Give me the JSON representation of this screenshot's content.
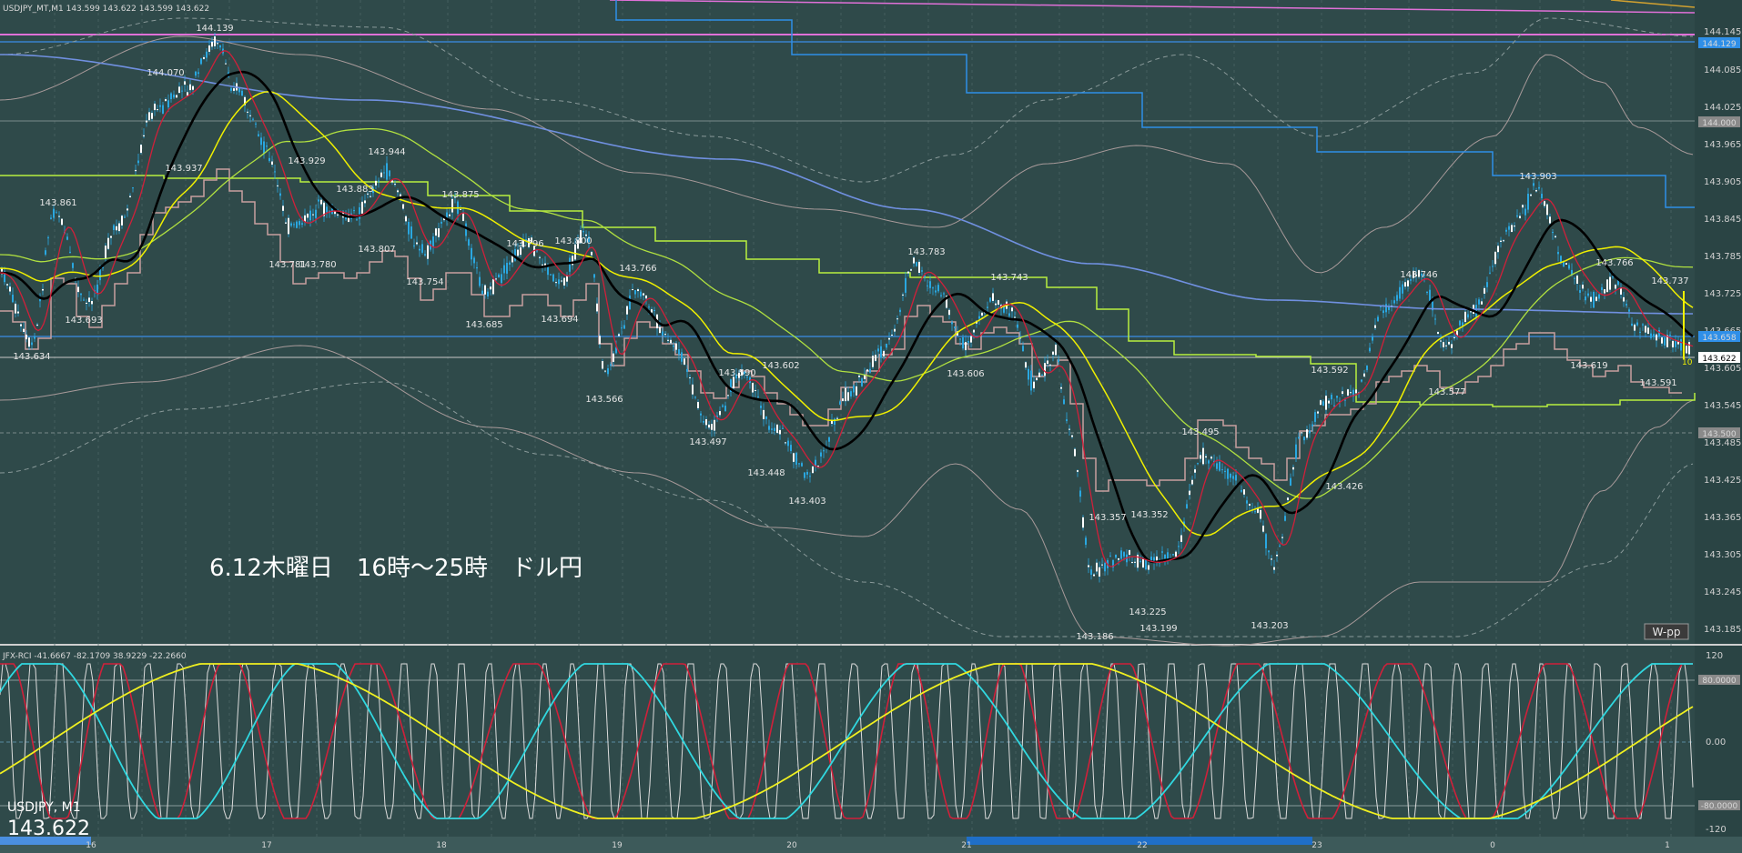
{
  "header": {
    "main_title": "USDJPY_MT,M1  143.599 143.622 143.599 143.622",
    "indicator_title": "JFX-RCI -41.6667 -82.1709 38.9229 -22.2660"
  },
  "annotation": "6.12木曜日　16時～25時　ドル円",
  "bottom_left": {
    "symbol": "USDJPY, M1",
    "price": "143.622"
  },
  "wpp_button": "W-pp",
  "price_axis_labels": [
    "144.145",
    "144.085",
    "144.025",
    "143.965",
    "143.905",
    "143.845",
    "143.785",
    "143.725",
    "143.665",
    "143.605",
    "143.545",
    "143.485",
    "143.425",
    "143.365",
    "143.305",
    "143.245",
    "143.185"
  ],
  "price_tags": {
    "blue_top": "144.129",
    "gray_144": "144.000",
    "blue_mid": "143.658",
    "current": "143.622",
    "gray_500": "143.500",
    "small_10": "10"
  },
  "rci_axis_labels": [
    "120",
    "80.0000",
    "0.00",
    "-80.0000",
    "-120"
  ],
  "time_labels": [
    "16",
    "17",
    "18",
    "19",
    "20",
    "21",
    "22",
    "23",
    "0",
    "1"
  ],
  "price_labels": [
    {
      "text": "144.139"
    },
    {
      "text": "144.070"
    },
    {
      "text": "143.861"
    },
    {
      "text": "143.937"
    },
    {
      "text": "143.929"
    },
    {
      "text": "143.944"
    },
    {
      "text": "143.883"
    },
    {
      "text": "143.875"
    },
    {
      "text": "143.796"
    },
    {
      "text": "143.800"
    },
    {
      "text": "143.766"
    },
    {
      "text": "143.781"
    },
    {
      "text": "143.780"
    },
    {
      "text": "143.807"
    },
    {
      "text": "143.754"
    },
    {
      "text": "143.693"
    },
    {
      "text": "143.634"
    },
    {
      "text": "143.685"
    },
    {
      "text": "143.694"
    },
    {
      "text": "143.566"
    },
    {
      "text": "143.590"
    },
    {
      "text": "143.602"
    },
    {
      "text": "143.497"
    },
    {
      "text": "143.448"
    },
    {
      "text": "143.403"
    },
    {
      "text": "143.783"
    },
    {
      "text": "143.743"
    },
    {
      "text": "143.606"
    },
    {
      "text": "143.495"
    },
    {
      "text": "143.357"
    },
    {
      "text": "143.352"
    },
    {
      "text": "143.225"
    },
    {
      "text": "143.199"
    },
    {
      "text": "143.186"
    },
    {
      "text": "143.203"
    },
    {
      "text": "143.592"
    },
    {
      "text": "143.426"
    },
    {
      "text": "143.746"
    },
    {
      "text": "143.577"
    },
    {
      "text": "143.903"
    },
    {
      "text": "143.766"
    },
    {
      "text": "143.737"
    },
    {
      "text": "143.619"
    },
    {
      "text": "143.591"
    }
  ],
  "colors": {
    "background": "#2f4a4a",
    "candle": "#2aa7e0",
    "ma_fast": "#d0203a",
    "ma_black": "#000000",
    "ma_yellow": "#f0f000",
    "ma_lightgreen": "#b0e040",
    "ma_blue": "#7090e0",
    "step_blue": "#2f8fe8",
    "step_lime": "#b8f040",
    "step_pink": "#c8a0a0",
    "bollinger": "#a89a9a",
    "rci_white": "#dcdcdc",
    "rci_red": "#d0203a",
    "rci_cyan": "#30d8e0",
    "rci_yellow": "#f0f020",
    "pink_line": "#e070d8"
  }
}
